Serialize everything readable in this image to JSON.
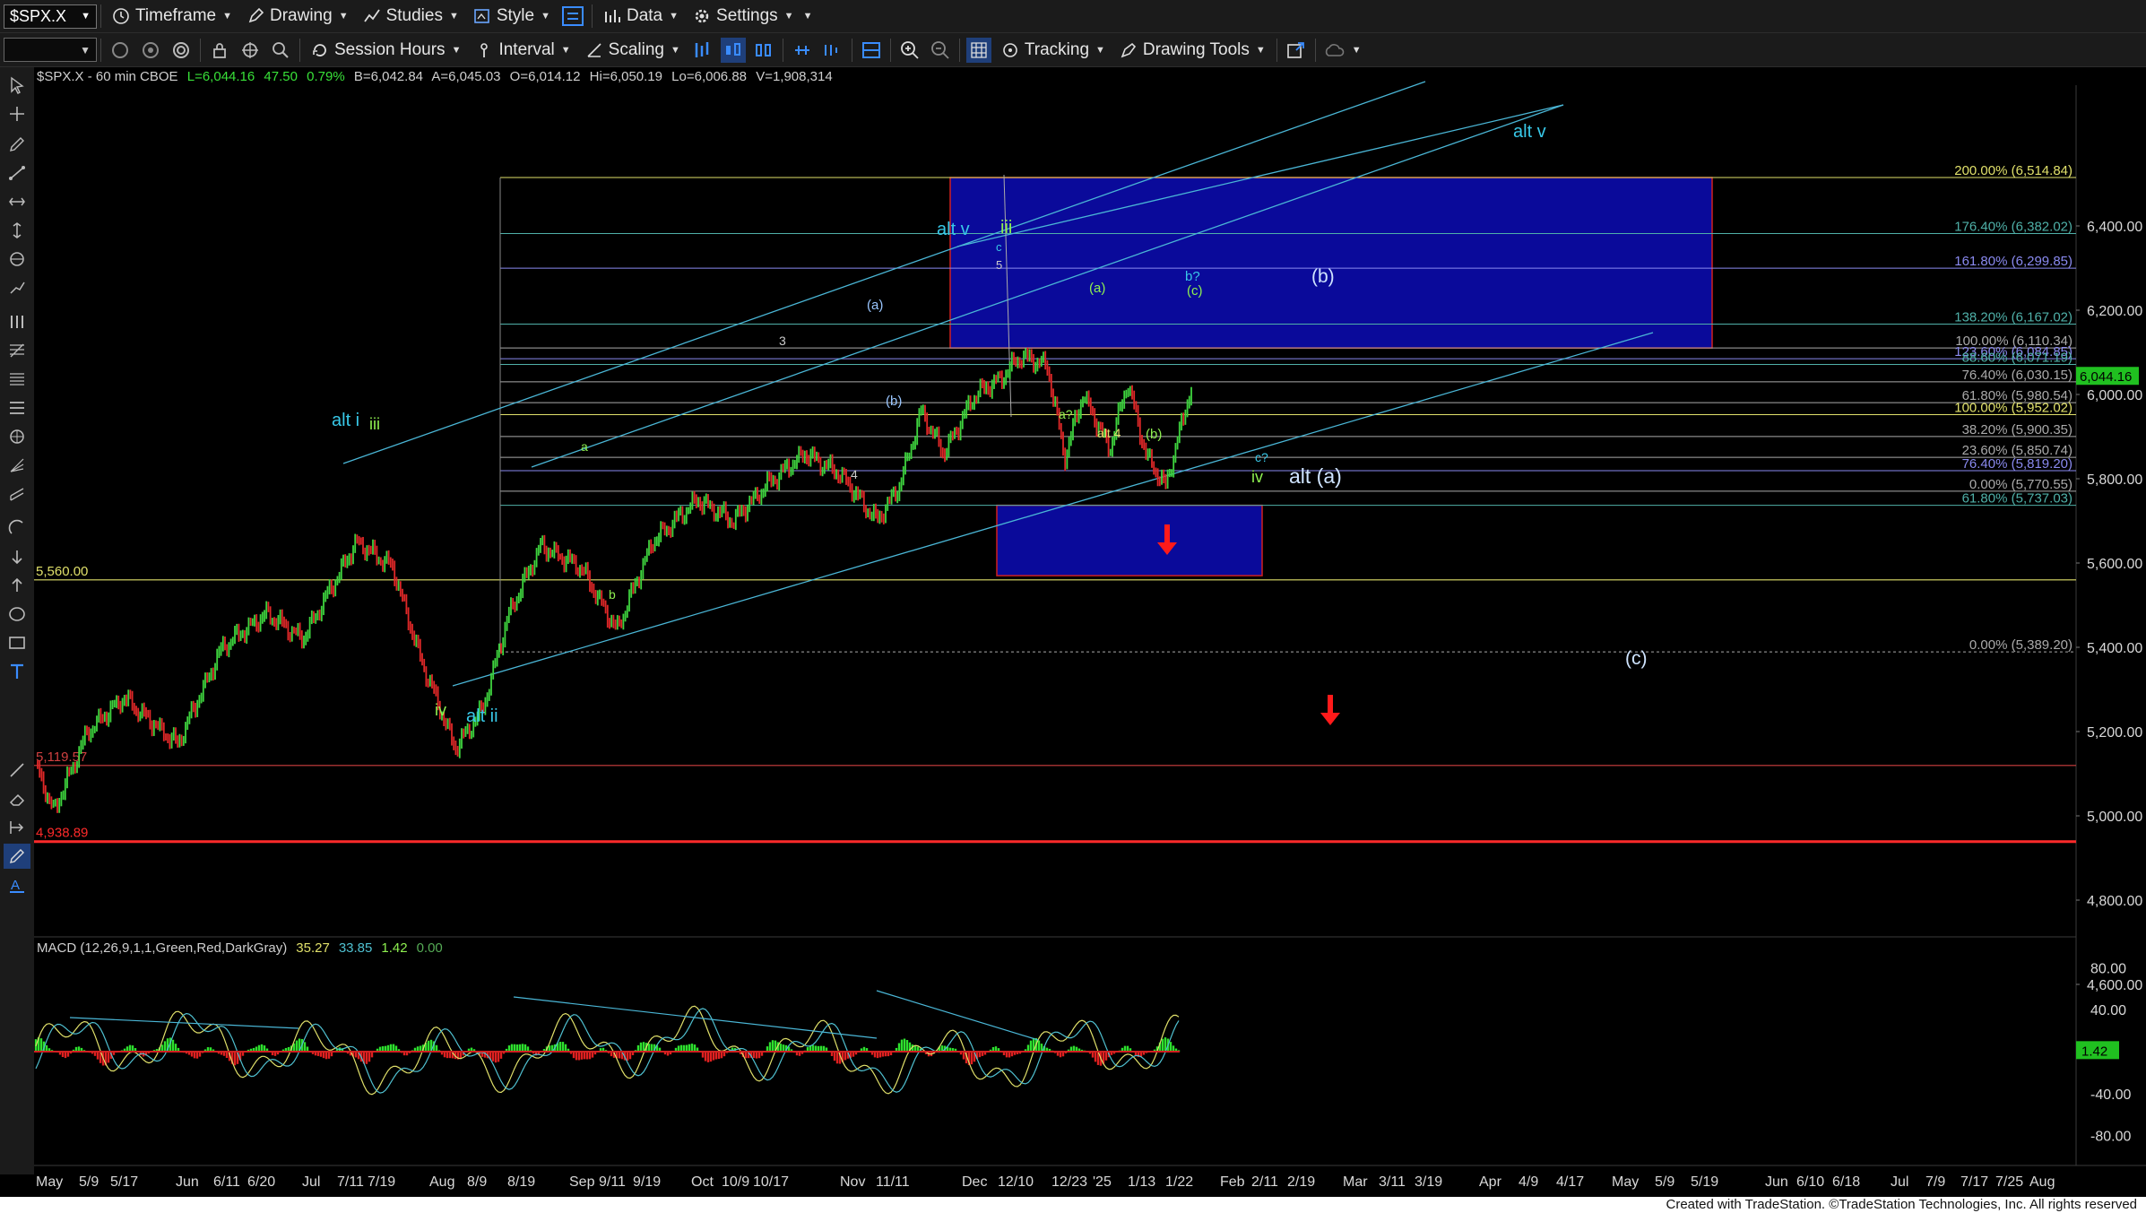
{
  "toolbar": {
    "symbol": "$SPX.X",
    "timeframe": "Timeframe",
    "drawing": "Drawing",
    "studies": "Studies",
    "style": "Style",
    "data": "Data",
    "settings": "Settings",
    "session_hours": "Session Hours",
    "interval": "Interval",
    "scaling": "Scaling",
    "tracking": "Tracking",
    "drawing_tools": "Drawing Tools"
  },
  "header": {
    "symbol_info": "$SPX.X - 60 min  CBOE",
    "last": "L=6,044.16",
    "change": "47.50",
    "change_pct": "0.79%",
    "bid": "B=6,042.84",
    "ask": "A=6,045.03",
    "open": "O=6,014.12",
    "high": "Hi=6,050.19",
    "low": "Lo=6,006.88",
    "volume": "V=1,908,314"
  },
  "price_axis": {
    "ticks": [
      {
        "value": 6400,
        "label": "6,400.00"
      },
      {
        "value": 6200,
        "label": "6,200.00"
      },
      {
        "value": 6000,
        "label": "6,000.00"
      },
      {
        "value": 5800,
        "label": "5,800.00"
      },
      {
        "value": 5600,
        "label": "5,600.00"
      },
      {
        "value": 5400,
        "label": "5,400.00"
      },
      {
        "value": 5200,
        "label": "5,200.00"
      },
      {
        "value": 5000,
        "label": "5,000.00"
      },
      {
        "value": 4800,
        "label": "4,800.00"
      },
      {
        "value": 4600,
        "label": "4,600.00"
      }
    ],
    "last_price_label": "6,044.16",
    "last_price": 6044.16
  },
  "fib_levels": [
    {
      "label": "200.00% (6,514.84)",
      "value": 6514.84,
      "color": "#e0e06a"
    },
    {
      "label": "176.40% (6,382.02)",
      "value": 6382.02,
      "color": "#4fb0a8"
    },
    {
      "label": "161.80% (6,299.85)",
      "value": 6299.85,
      "color": "#8a8af0"
    },
    {
      "label": "138.20% (6,167.02)",
      "value": 6167.02,
      "color": "#4fb0a8"
    },
    {
      "label": "100.00% (6,110.34)",
      "value": 6110.34,
      "color": "#aaaaaa"
    },
    {
      "label": "123.60% (6,084.85)",
      "value": 6084.85,
      "color": "#8a8af0"
    },
    {
      "label": "88.60% (6,071.19)",
      "value": 6071.19,
      "color": "#4fb0a8"
    },
    {
      "label": "76.40% (6,030.15)",
      "value": 6030.15,
      "color": "#aaaaaa"
    },
    {
      "label": "61.80% (5,980.54)",
      "value": 5980.54,
      "color": "#aaaaaa"
    },
    {
      "label": "100.00% (5,952.02)",
      "value": 5952.02,
      "color": "#e0e06a"
    },
    {
      "label": "38.20% (5,900.35)",
      "value": 5900.35,
      "color": "#aaaaaa"
    },
    {
      "label": "23.60% (5,850.74)",
      "value": 5850.74,
      "color": "#aaaaaa"
    },
    {
      "label": "76.40% (5,819.20)",
      "value": 5819.2,
      "color": "#8a8af0"
    },
    {
      "label": "0.00% (5,770.55)",
      "value": 5770.55,
      "color": "#aaaaaa"
    },
    {
      "label": "61.80% (5,737.03)",
      "value": 5737.03,
      "color": "#4fb0a8"
    },
    {
      "label": "0.00% (5,389.20)",
      "value": 5389.2,
      "color": "#aaaaaa"
    }
  ],
  "horizontal_levels": [
    {
      "label": "5,560.00",
      "value": 5560,
      "color": "#e0e06a"
    },
    {
      "label": "5,119.57",
      "value": 5119.57,
      "color": "#d04040"
    },
    {
      "label": "4,938.89",
      "value": 4938.89,
      "color": "#ff2a2a"
    }
  ],
  "wave_labels": [
    {
      "text": "alt i",
      "color": "#38c8e8"
    },
    {
      "text": "iii",
      "color": "#8ef050"
    },
    {
      "text": "iv",
      "color": "#8ef050"
    },
    {
      "text": "alt ii",
      "color": "#38c8e8"
    },
    {
      "text": "a",
      "color": "#8ef050"
    },
    {
      "text": "b",
      "color": "#8ef050"
    },
    {
      "text": "3",
      "color": "#cccccc"
    },
    {
      "text": "4",
      "color": "#cccccc"
    },
    {
      "text": "(a)",
      "color": "#9ac6ff"
    },
    {
      "text": "(b)",
      "color": "#9ac6ff"
    },
    {
      "text": "alt v",
      "color": "#38c8e8"
    },
    {
      "text": "iii",
      "color": "#8ef050"
    },
    {
      "text": "c",
      "color": "#38c8e8"
    },
    {
      "text": "5",
      "color": "#cccccc"
    },
    {
      "text": "(a)",
      "color": "#8ef050"
    },
    {
      "text": "a?",
      "color": "#8ef050"
    },
    {
      "text": "alt 4",
      "color": "#e0e06a"
    },
    {
      "text": "(b)",
      "color": "#8ef050"
    },
    {
      "text": "b?",
      "color": "#38c8e8"
    },
    {
      "text": "(c)",
      "color": "#8ef050"
    },
    {
      "text": "c?",
      "color": "#38c8e8"
    },
    {
      "text": "iv",
      "color": "#8ef050"
    },
    {
      "text": "alt (a)",
      "color": "#cfe4ff"
    },
    {
      "text": "(b)",
      "color": "#cfe4ff"
    },
    {
      "text": "(c)",
      "color": "#cfe4ff"
    },
    {
      "text": "alt v",
      "color": "#38c8e8"
    }
  ],
  "macd": {
    "label": "MACD (12,26,9,1,1,Green,Red,DarkGray)",
    "values": [
      "35.27",
      "33.85",
      "1.42",
      "0.00"
    ],
    "colors": [
      "#e0e06a",
      "#4fc0d0",
      "#8ef050",
      "#55aa55"
    ],
    "ticks": [
      {
        "value": 80,
        "label": "80.00"
      },
      {
        "value": 40,
        "label": "40.00"
      },
      {
        "value": -40,
        "label": "-40.00"
      },
      {
        "value": -80,
        "label": "-80.00"
      }
    ],
    "current_label": "1.42",
    "current": 1.42
  },
  "date_axis": [
    "May",
    "5/9",
    "5/17",
    "Jun",
    "6/11",
    "6/20",
    "Jul",
    "7/11",
    "7/19",
    "Aug",
    "8/9",
    "8/19",
    "Sep",
    "9/11",
    "9/19",
    "Oct",
    "10/9",
    "10/17",
    "Nov",
    "11/11",
    "Dec",
    "12/10",
    "12/23",
    "'25",
    "1/13",
    "1/22",
    "Feb",
    "2/11",
    "2/19",
    "Mar",
    "3/11",
    "3/19",
    "Apr",
    "4/9",
    "4/17",
    "May",
    "5/9",
    "5/19",
    "Jun",
    "6/10",
    "6/18",
    "Jul",
    "7/9",
    "7/17",
    "7/25",
    "Aug"
  ],
  "footer": "Created with TradeStation. ©TradeStation Technologies, Inc. All rights reserved",
  "colors": {
    "up_bar": "#3ed43e",
    "down_bar": "#e02828",
    "target_box": "#0a0a9a",
    "channel": "#4ab6d6",
    "macd_fast": "#e0e06a",
    "macd_slow": "#4fc0d0"
  }
}
